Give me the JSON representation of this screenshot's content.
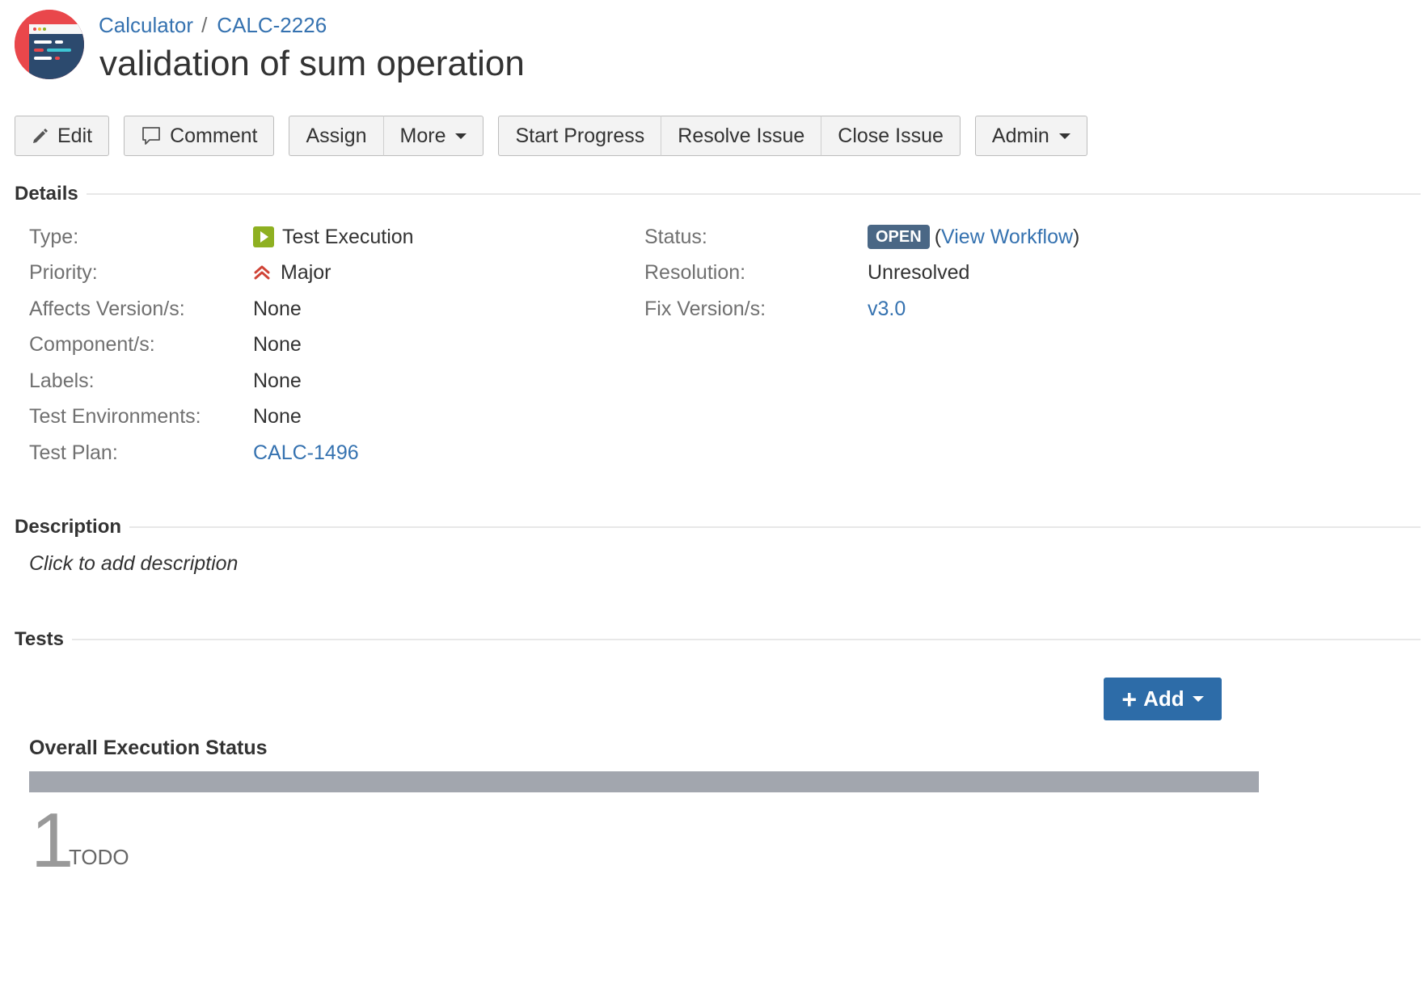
{
  "breadcrumb": {
    "project": "Calculator",
    "separator": "/",
    "issue_key": "CALC-2226"
  },
  "title": "validation of sum operation",
  "toolbar": {
    "edit": "Edit",
    "comment": "Comment",
    "assign": "Assign",
    "more": "More",
    "start_progress": "Start Progress",
    "resolve_issue": "Resolve Issue",
    "close_issue": "Close Issue",
    "admin": "Admin"
  },
  "details": {
    "heading": "Details",
    "left": [
      {
        "label": "Type:",
        "value": "Test Execution",
        "icon": "test-execution-icon"
      },
      {
        "label": "Priority:",
        "value": "Major",
        "icon": "priority-major-icon"
      },
      {
        "label": "Affects Version/s:",
        "value": "None"
      },
      {
        "label": "Component/s:",
        "value": "None"
      },
      {
        "label": "Labels:",
        "value": "None"
      },
      {
        "label": "Test Environments:",
        "value": "None"
      },
      {
        "label": "Test Plan:",
        "value": "CALC-1496"
      }
    ],
    "right": {
      "status_label": "Status:",
      "status_value": "OPEN",
      "view_workflow_open": "(",
      "view_workflow": "View Workflow",
      "view_workflow_close": ")",
      "resolution_label": "Resolution:",
      "resolution_value": "Unresolved",
      "fix_version_label": "Fix Version/s:",
      "fix_version_value": "v3.0"
    }
  },
  "description": {
    "heading": "Description",
    "placeholder": "Click to add description"
  },
  "tests": {
    "heading": "Tests",
    "add_button": "Add",
    "overall_status_title": "Overall Execution Status",
    "todo_fraction": 1.0,
    "todo_count": "1",
    "todo_label": "TODO"
  },
  "colors": {
    "link": "#3572b0",
    "status_open": "#4a6785",
    "type_icon": "#8eb021",
    "priority_major": "#d04437",
    "add_button": "#2d6ca8",
    "todo_bar": "#a2a6ae"
  }
}
